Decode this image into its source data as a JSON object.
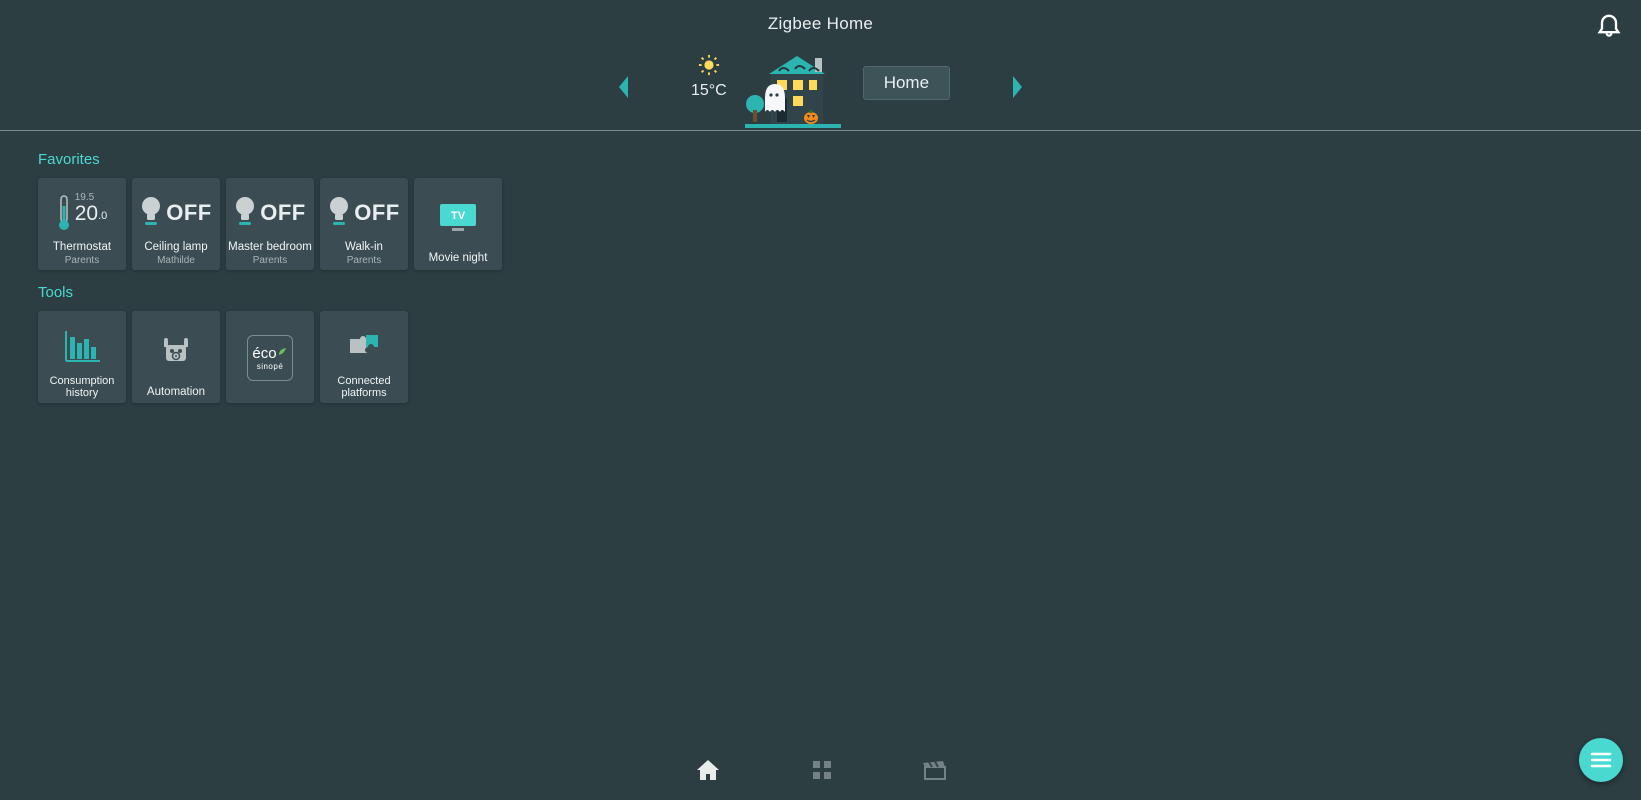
{
  "header": {
    "title": "Zigbee Home"
  },
  "weather": {
    "temp": "15°C"
  },
  "location": {
    "current": "Home"
  },
  "sections": {
    "favorites_title": "Favorites",
    "tools_title": "Tools"
  },
  "favorites": [
    {
      "kind": "thermostat",
      "small": "19.5",
      "value_whole": "20",
      "value_dec": ".0",
      "label": "Thermostat",
      "sub": "Parents"
    },
    {
      "kind": "light",
      "state": "OFF",
      "label": "Ceiling lamp",
      "sub": "Mathilde"
    },
    {
      "kind": "light",
      "state": "OFF",
      "label": "Master bedroom",
      "sub": "Parents"
    },
    {
      "kind": "light",
      "state": "OFF",
      "label": "Walk-in",
      "sub": "Parents"
    },
    {
      "kind": "scene",
      "icon": "tv",
      "icon_text": "TV",
      "label": "Movie night",
      "sub": ""
    }
  ],
  "tools": [
    {
      "icon": "chart",
      "label": "Consumption history"
    },
    {
      "icon": "robot",
      "label": "Automation"
    },
    {
      "icon": "eco",
      "eco_top": "éco",
      "eco_bottom": "sinopé",
      "label": ""
    },
    {
      "icon": "puzzle",
      "label": "Connected platforms"
    }
  ],
  "colors": {
    "teal": "#2cb5b0",
    "teal_light": "#4ad9d1",
    "bg": "#2c3e42",
    "tile": "#3b4d52",
    "yellow": "#ffd95a"
  }
}
